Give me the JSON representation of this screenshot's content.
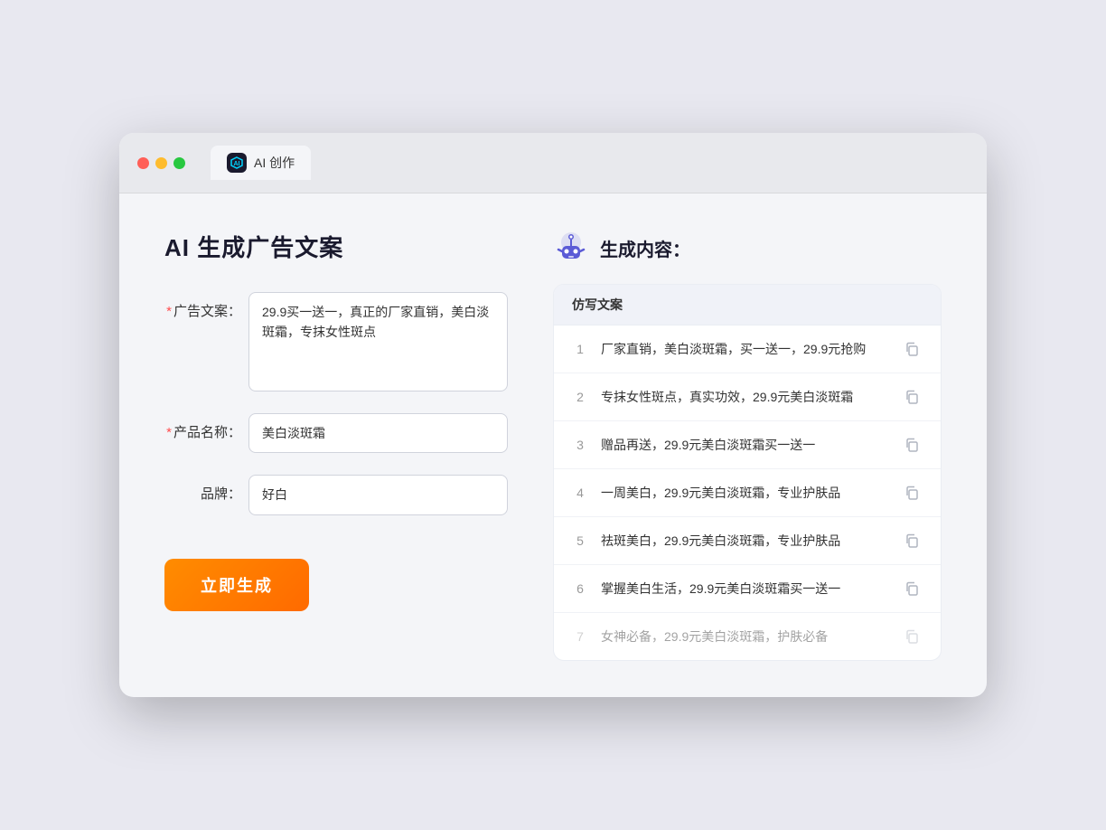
{
  "tab": {
    "title": "AI 创作",
    "icon_text": "AI"
  },
  "left": {
    "page_title": "AI 生成广告文案",
    "form": {
      "ad_copy_label": "广告文案：",
      "ad_copy_value": "29.9买一送一，真正的厂家直销，美白淡斑霜，专抹女性斑点",
      "product_label": "产品名称：",
      "product_value": "美白淡斑霜",
      "brand_label": "品牌：",
      "brand_value": "好白"
    },
    "generate_button": "立即生成"
  },
  "right": {
    "title": "生成内容：",
    "table_header": "仿写文案",
    "results": [
      {
        "num": "1",
        "text": "厂家直销，美白淡斑霜，买一送一，29.9元抢购",
        "dimmed": false
      },
      {
        "num": "2",
        "text": "专抹女性斑点，真实功效，29.9元美白淡斑霜",
        "dimmed": false
      },
      {
        "num": "3",
        "text": "赠品再送，29.9元美白淡斑霜买一送一",
        "dimmed": false
      },
      {
        "num": "4",
        "text": "一周美白，29.9元美白淡斑霜，专业护肤品",
        "dimmed": false
      },
      {
        "num": "5",
        "text": "祛斑美白，29.9元美白淡斑霜，专业护肤品",
        "dimmed": false
      },
      {
        "num": "6",
        "text": "掌握美白生活，29.9元美白淡斑霜买一送一",
        "dimmed": false
      },
      {
        "num": "7",
        "text": "女神必备，29.9元美白淡斑霜，护肤必备",
        "dimmed": true
      }
    ]
  }
}
